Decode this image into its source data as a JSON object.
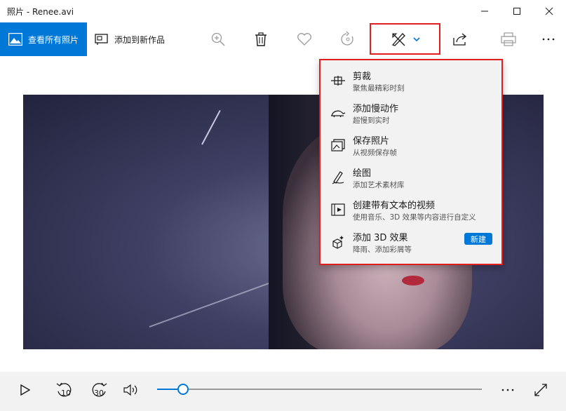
{
  "window": {
    "title": "照片 - Renee.avi",
    "minimize_icon": "minimize-icon",
    "maximize_icon": "maximize-icon",
    "close_icon": "close-icon"
  },
  "toolbar": {
    "view_all_label": "查看所有照片",
    "add_to_creation_label": "添加到新作品",
    "icons": [
      "zoom-in-icon",
      "delete-icon",
      "favorite-icon",
      "rotate-icon",
      "edit-create-icon",
      "share-icon",
      "print-icon",
      "more-icon"
    ]
  },
  "menu": {
    "items": [
      {
        "title": "剪裁",
        "subtitle": "聚焦最精彩时刻",
        "icon": "trim-icon"
      },
      {
        "title": "添加慢动作",
        "subtitle": "超慢到实时",
        "icon": "slow-motion-icon"
      },
      {
        "title": "保存照片",
        "subtitle": "从视频保存帧",
        "icon": "save-photo-icon"
      },
      {
        "title": "绘图",
        "subtitle": "添加艺术素材库",
        "icon": "draw-icon"
      },
      {
        "title": "创建带有文本的视频",
        "subtitle": "使用音乐、3D 效果等内容进行自定义",
        "icon": "video-text-icon"
      },
      {
        "title": "添加 3D 效果",
        "subtitle": "降雨、添加彩屑等",
        "icon": "3d-effects-icon",
        "badge": "新建"
      }
    ]
  },
  "playback": {
    "progress": 0.08,
    "skip_back_label": "10",
    "skip_forward_label": "30"
  },
  "colors": {
    "accent": "#0078d7",
    "highlight": "#e01e1e"
  }
}
